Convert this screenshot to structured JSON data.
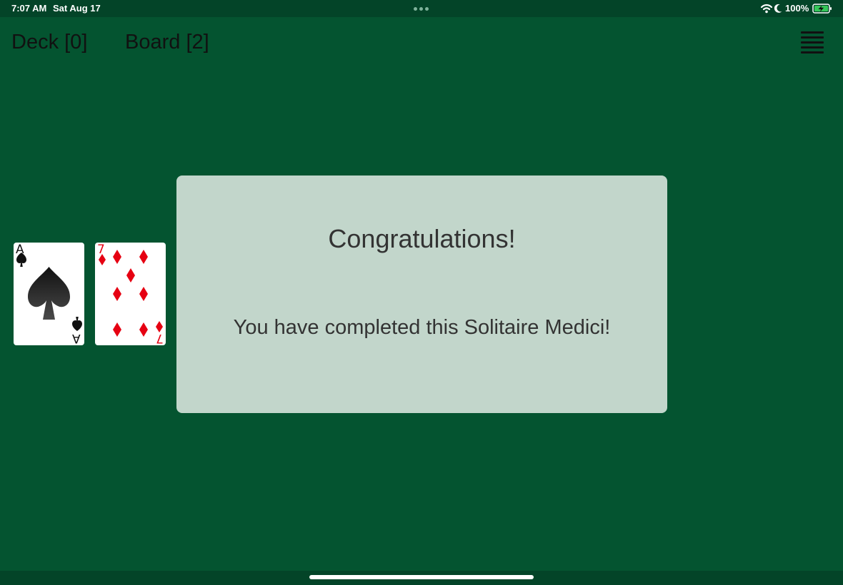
{
  "status_bar": {
    "time": "7:07 AM",
    "date": "Sat Aug 17",
    "battery": "100%",
    "icons": [
      "wifi-icon",
      "moon-icon",
      "battery-charging-icon",
      "more-dots-icon"
    ]
  },
  "header": {
    "deck_label": "Deck [0]",
    "board_label": "Board [2]",
    "menu_icon": "hamburger-menu-icon"
  },
  "board": {
    "cards": [
      {
        "rank": "A",
        "suit": "spades",
        "suit_icon": "spade-icon",
        "color": "#111111"
      },
      {
        "rank": "7",
        "suit": "diamonds",
        "suit_icon": "diamond-icon",
        "color": "#e60012"
      }
    ]
  },
  "dialog": {
    "title": "Congratulations!",
    "message": "You have completed this Solitaire Medici!"
  },
  "colors": {
    "table": "#045430",
    "status_bar": "#034428",
    "dialog_background": "#c2d6cb",
    "dialog_text": "#333333",
    "card_red": "#e60012",
    "card_black": "#111111"
  }
}
